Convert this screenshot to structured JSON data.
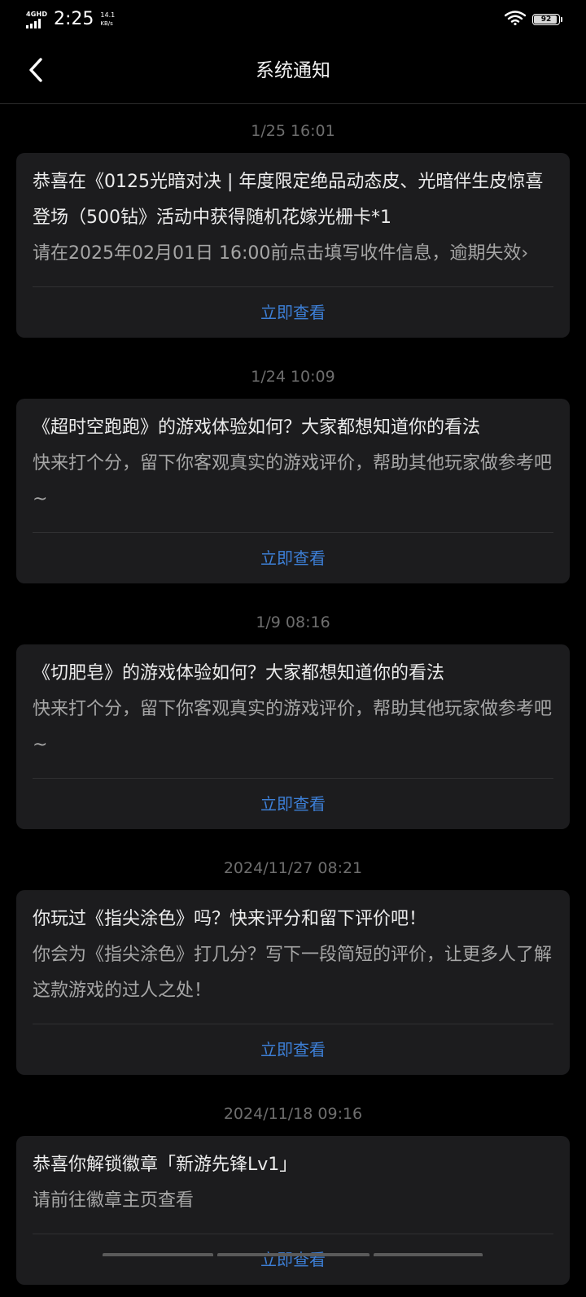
{
  "status_bar": {
    "network_type": "4GHD",
    "time": "2:25",
    "speed_value": "14.1",
    "speed_unit": "KB/s",
    "battery_level": "92",
    "battery_fraction": 0.92
  },
  "nav": {
    "title": "系统通知"
  },
  "messages": [
    {
      "date": "1/25  16:01",
      "title": "恭喜在《0125光暗对决 | 年度限定绝品动态皮、光暗伴生皮惊喜登场（500钻》活动中获得随机花嫁光栅卡*1",
      "body": "请在2025年02月01日 16:00前点击填写收件信息，逾期失效›",
      "action": "立即查看"
    },
    {
      "date": "1/24  10:09",
      "title": "《超时空跑跑》的游戏体验如何？大家都想知道你的看法",
      "body": "快来打个分，留下你客观真实的游戏评价，帮助其他玩家做参考吧~",
      "action": "立即查看"
    },
    {
      "date": "1/9  08:16",
      "title": "《切肥皂》的游戏体验如何？大家都想知道你的看法",
      "body": "快来打个分，留下你客观真实的游戏评价，帮助其他玩家做参考吧~",
      "action": "立即查看"
    },
    {
      "date": "2024/11/27  08:21",
      "title": "你玩过《指尖涂色》吗？快来评分和留下评价吧！",
      "body": "你会为《指尖涂色》打几分？写下一段简短的评价，让更多人了解这款游戏的过人之处！",
      "action": "立即查看"
    },
    {
      "date": "2024/11/18  09:16",
      "title": "恭喜你解锁徽章「新游先锋Lv1」",
      "body": "请前往徽章主页查看",
      "action": "立即查看"
    }
  ],
  "colors": {
    "background": "#000000",
    "card": "#1c1c1e",
    "accent": "#3d7fd6",
    "date_text": "#6e6e6e",
    "body_text": "#a6a6a6"
  }
}
